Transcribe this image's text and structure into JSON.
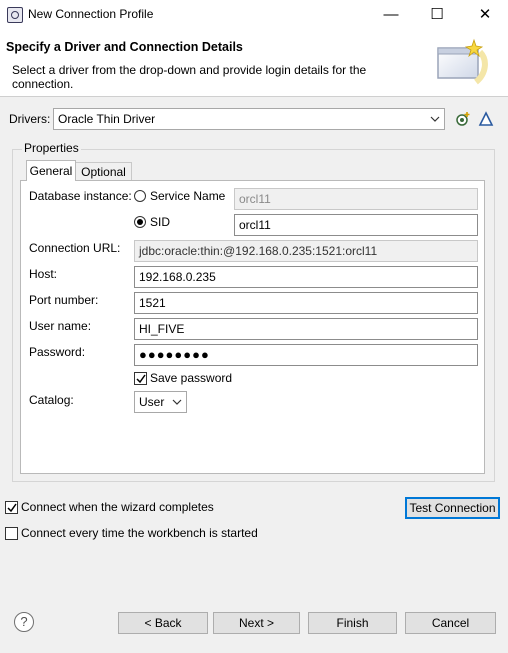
{
  "window": {
    "title": "New Connection Profile",
    "minimize_glyph": "—",
    "maximize_glyph": "☐",
    "close_glyph": "✕"
  },
  "header": {
    "title": "Specify a Driver and Connection Details",
    "description": "Select a driver from the drop-down and provide login details for the connection."
  },
  "drivers": {
    "label": "Drivers:",
    "selected": "Oracle Thin Driver"
  },
  "properties": {
    "group_label": "Properties",
    "tabs": [
      {
        "label": "General"
      },
      {
        "label": "Optional"
      }
    ],
    "database_instance": {
      "label": "Database instance:",
      "service_name_label": "Service Name",
      "service_name_value": "orcl11",
      "sid_label": "SID",
      "sid_value": "orcl11",
      "selected": "SID"
    },
    "connection_url": {
      "label": "Connection URL:",
      "value": "jdbc:oracle:thin:@192.168.0.235:1521:orcl11"
    },
    "host": {
      "label": "Host:",
      "value": "192.168.0.235"
    },
    "port": {
      "label": "Port number:",
      "value": "1521"
    },
    "user": {
      "label": "User name:",
      "value": "HI_FIVE"
    },
    "password": {
      "label": "Password:",
      "masked_value": "●●●●●●●●"
    },
    "save_password": {
      "label": "Save password",
      "checked": true
    },
    "catalog": {
      "label": "Catalog:",
      "selected": "User"
    }
  },
  "options": {
    "connect_on_finish": {
      "label": "Connect when the wizard completes",
      "checked": true
    },
    "connect_every_time": {
      "label": "Connect every time the workbench is started",
      "checked": false
    }
  },
  "buttons": {
    "test_connection": "Test Connection",
    "back": "< Back",
    "next": "Next >",
    "finish": "Finish",
    "cancel": "Cancel",
    "help_glyph": "?"
  },
  "colors": {
    "accent": "#0078d7",
    "dialog_bg": "#f0f0f0",
    "panel_bg": "#ffffff"
  }
}
